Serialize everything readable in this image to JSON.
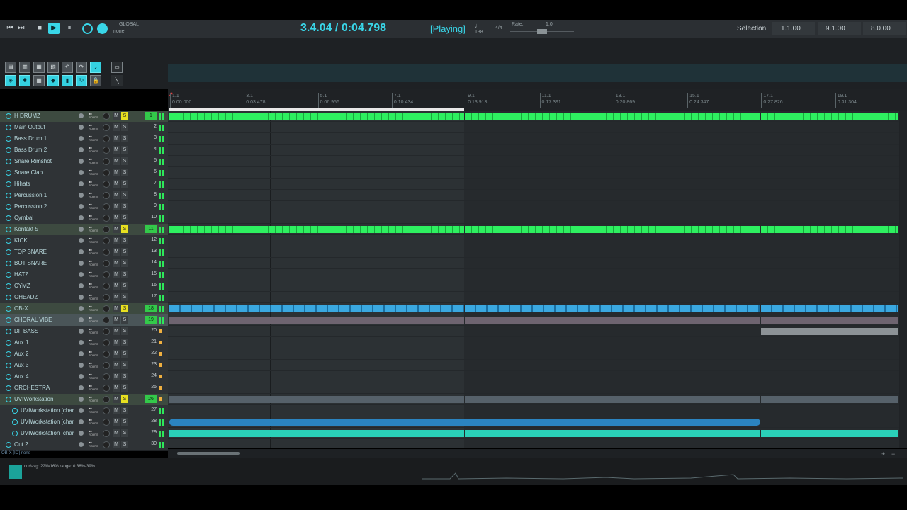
{
  "transport": {
    "time": "3.4.04 / 0:04.798",
    "status": "[Playing]",
    "global_label": "GLOBAL",
    "global_value": "none",
    "bpm": "138",
    "time_sig": "4/4",
    "rate_label": "Rate:",
    "rate_value": "1.0",
    "selection_label": "Selection:",
    "selection_start": "1.1.00",
    "selection_end": "9.1.00",
    "selection_length": "8.0.00",
    "colors": {
      "accent": "#39d6e8",
      "solo": "#e8e020",
      "meter": "#2ee85a"
    }
  },
  "ruler": [
    {
      "bar": "1.1",
      "time": "0:00.000"
    },
    {
      "bar": "3.1",
      "time": "0:03.478"
    },
    {
      "bar": "5.1",
      "time": "0:06.956"
    },
    {
      "bar": "7.1",
      "time": "0:10.434"
    },
    {
      "bar": "9.1",
      "time": "0:13.913"
    },
    {
      "bar": "11.1",
      "time": "0:17.391"
    },
    {
      "bar": "13.1",
      "time": "0:20.869"
    },
    {
      "bar": "15.1",
      "time": "0:24.347"
    },
    {
      "bar": "17.1",
      "time": "0:27.826"
    },
    {
      "bar": "19.1",
      "time": "0:31.304"
    }
  ],
  "tracks": [
    {
      "name": "H DRUMZ",
      "num": "1"
    },
    {
      "name": "Main Output",
      "num": "2"
    },
    {
      "name": "Bass Drum 1",
      "num": "3"
    },
    {
      "name": "Bass Drum 2",
      "num": "4"
    },
    {
      "name": "Snare Rimshot",
      "num": "5"
    },
    {
      "name": "Snare Clap",
      "num": "6"
    },
    {
      "name": "Hihats",
      "num": "7"
    },
    {
      "name": "Percussion 1",
      "num": "8"
    },
    {
      "name": "Percussion 2",
      "num": "9"
    },
    {
      "name": "Cymbal",
      "num": "10"
    },
    {
      "name": "Kontakt 5",
      "num": "11"
    },
    {
      "name": "KICK",
      "num": "12"
    },
    {
      "name": "TOP SNARE",
      "num": "13"
    },
    {
      "name": "BOT SNARE",
      "num": "14"
    },
    {
      "name": "HATZ",
      "num": "15"
    },
    {
      "name": "CYMZ",
      "num": "16"
    },
    {
      "name": "OHEADZ",
      "num": "17"
    },
    {
      "name": "OB-X",
      "num": "18"
    },
    {
      "name": "CHORAL VIBE",
      "num": "19"
    },
    {
      "name": "DF BASS",
      "num": "20"
    },
    {
      "name": "Aux 1",
      "num": "21"
    },
    {
      "name": "Aux 2",
      "num": "22"
    },
    {
      "name": "Aux 3",
      "num": "23"
    },
    {
      "name": "Aux 4",
      "num": "24"
    },
    {
      "name": "ORCHESTRA",
      "num": "25"
    },
    {
      "name": "UVIWorkstation",
      "num": "26"
    },
    {
      "name": "UVIWorkstation [char",
      "num": "27"
    },
    {
      "name": "UVIWorkstation [char",
      "num": "28"
    },
    {
      "name": "UVIWorkstation [char",
      "num": "29"
    },
    {
      "name": "Out 2",
      "num": "30"
    }
  ],
  "strip_labels": {
    "mute": "M",
    "solo": "S",
    "route": "ROUTE"
  },
  "footer": {
    "now_playing": "OB-X [IO] none",
    "cpu": "cur/avg: 22%/16%   range: 0.38%-39%"
  }
}
